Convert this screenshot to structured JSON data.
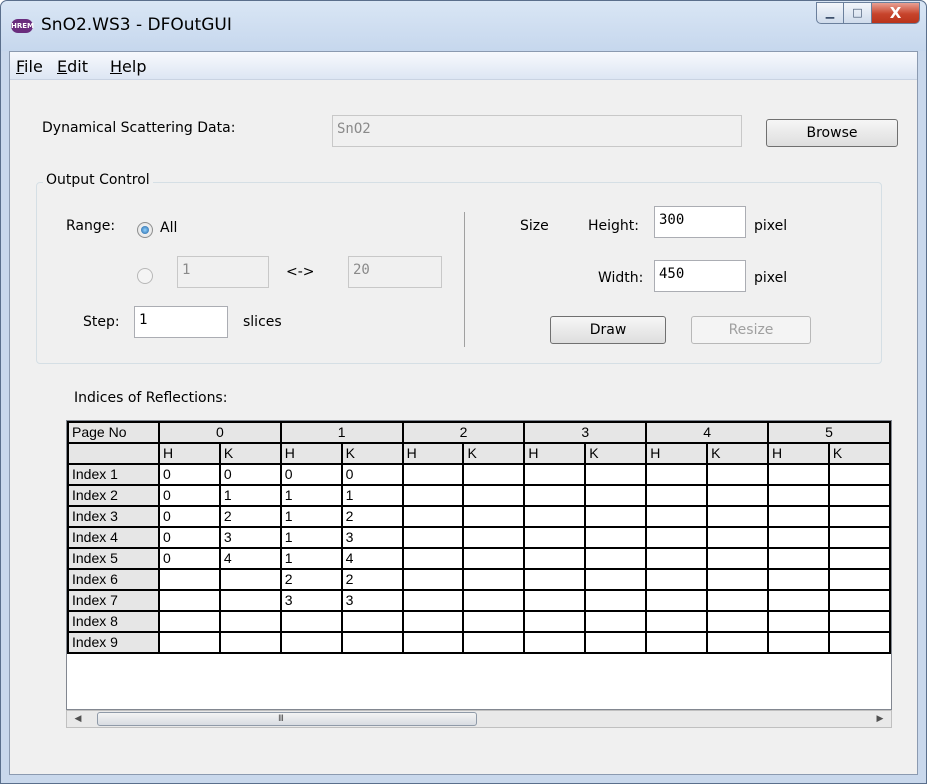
{
  "window": {
    "title": "SnO2.WS3 - DFOutGUI",
    "icon_text": "HREM",
    "minimize_glyph": "▁",
    "maximize_glyph": "□",
    "close_glyph": "X"
  },
  "menu": [
    {
      "accel": "F",
      "rest": "ile"
    },
    {
      "accel": "E",
      "rest": "dit"
    },
    {
      "accel": "H",
      "rest": "elp"
    }
  ],
  "data_section": {
    "label": "Dynamical Scattering Data:",
    "value": "SnO2",
    "browse_label": "Browse"
  },
  "output_control": {
    "legend": "Output Control",
    "range_label": "Range:",
    "all_label": "All",
    "range_all_selected": true,
    "range_from": "1",
    "range_sep": "<->",
    "range_to": "20",
    "step_label": "Step:",
    "step_value": "1",
    "step_unit": "slices",
    "size_label": "Size",
    "height_label": "Height:",
    "height_value": "300",
    "width_label": "Width:",
    "width_value": "450",
    "pixel_unit": "pixel",
    "draw_label": "Draw",
    "resize_label": "Resize"
  },
  "reflections": {
    "label": "Indices of Reflections:",
    "page_header": "Page No",
    "pages": [
      "0",
      "1",
      "2",
      "3",
      "4",
      "5"
    ],
    "sub_h": "H",
    "sub_k": "K",
    "rows": [
      {
        "label": "Index 1",
        "cells": [
          "0",
          "0",
          "0",
          "0",
          "",
          "",
          "",
          "",
          "",
          "",
          "",
          ""
        ]
      },
      {
        "label": "Index 2",
        "cells": [
          "0",
          "1",
          "1",
          "1",
          "",
          "",
          "",
          "",
          "",
          "",
          "",
          ""
        ]
      },
      {
        "label": "Index 3",
        "cells": [
          "0",
          "2",
          "1",
          "2",
          "",
          "",
          "",
          "",
          "",
          "",
          "",
          ""
        ]
      },
      {
        "label": "Index 4",
        "cells": [
          "0",
          "3",
          "1",
          "3",
          "",
          "",
          "",
          "",
          "",
          "",
          "",
          ""
        ]
      },
      {
        "label": "Index 5",
        "cells": [
          "0",
          "4",
          "1",
          "4",
          "",
          "",
          "",
          "",
          "",
          "",
          "",
          ""
        ]
      },
      {
        "label": "Index 6",
        "cells": [
          "",
          "",
          "2",
          "2",
          "",
          "",
          "",
          "",
          "",
          "",
          "",
          ""
        ]
      },
      {
        "label": "Index 7",
        "cells": [
          "",
          "",
          "3",
          "3",
          "",
          "",
          "",
          "",
          "",
          "",
          "",
          ""
        ]
      },
      {
        "label": "Index 8",
        "cells": [
          "",
          "",
          "",
          "",
          "",
          "",
          "",
          "",
          "",
          "",
          "",
          ""
        ]
      },
      {
        "label": "Index 9",
        "cells": [
          "",
          "",
          "",
          "",
          "",
          "",
          "",
          "",
          "",
          "",
          "",
          ""
        ]
      }
    ]
  },
  "scrollbar": {
    "left_arrow": "◀",
    "right_arrow": "▶",
    "grip": "III"
  }
}
